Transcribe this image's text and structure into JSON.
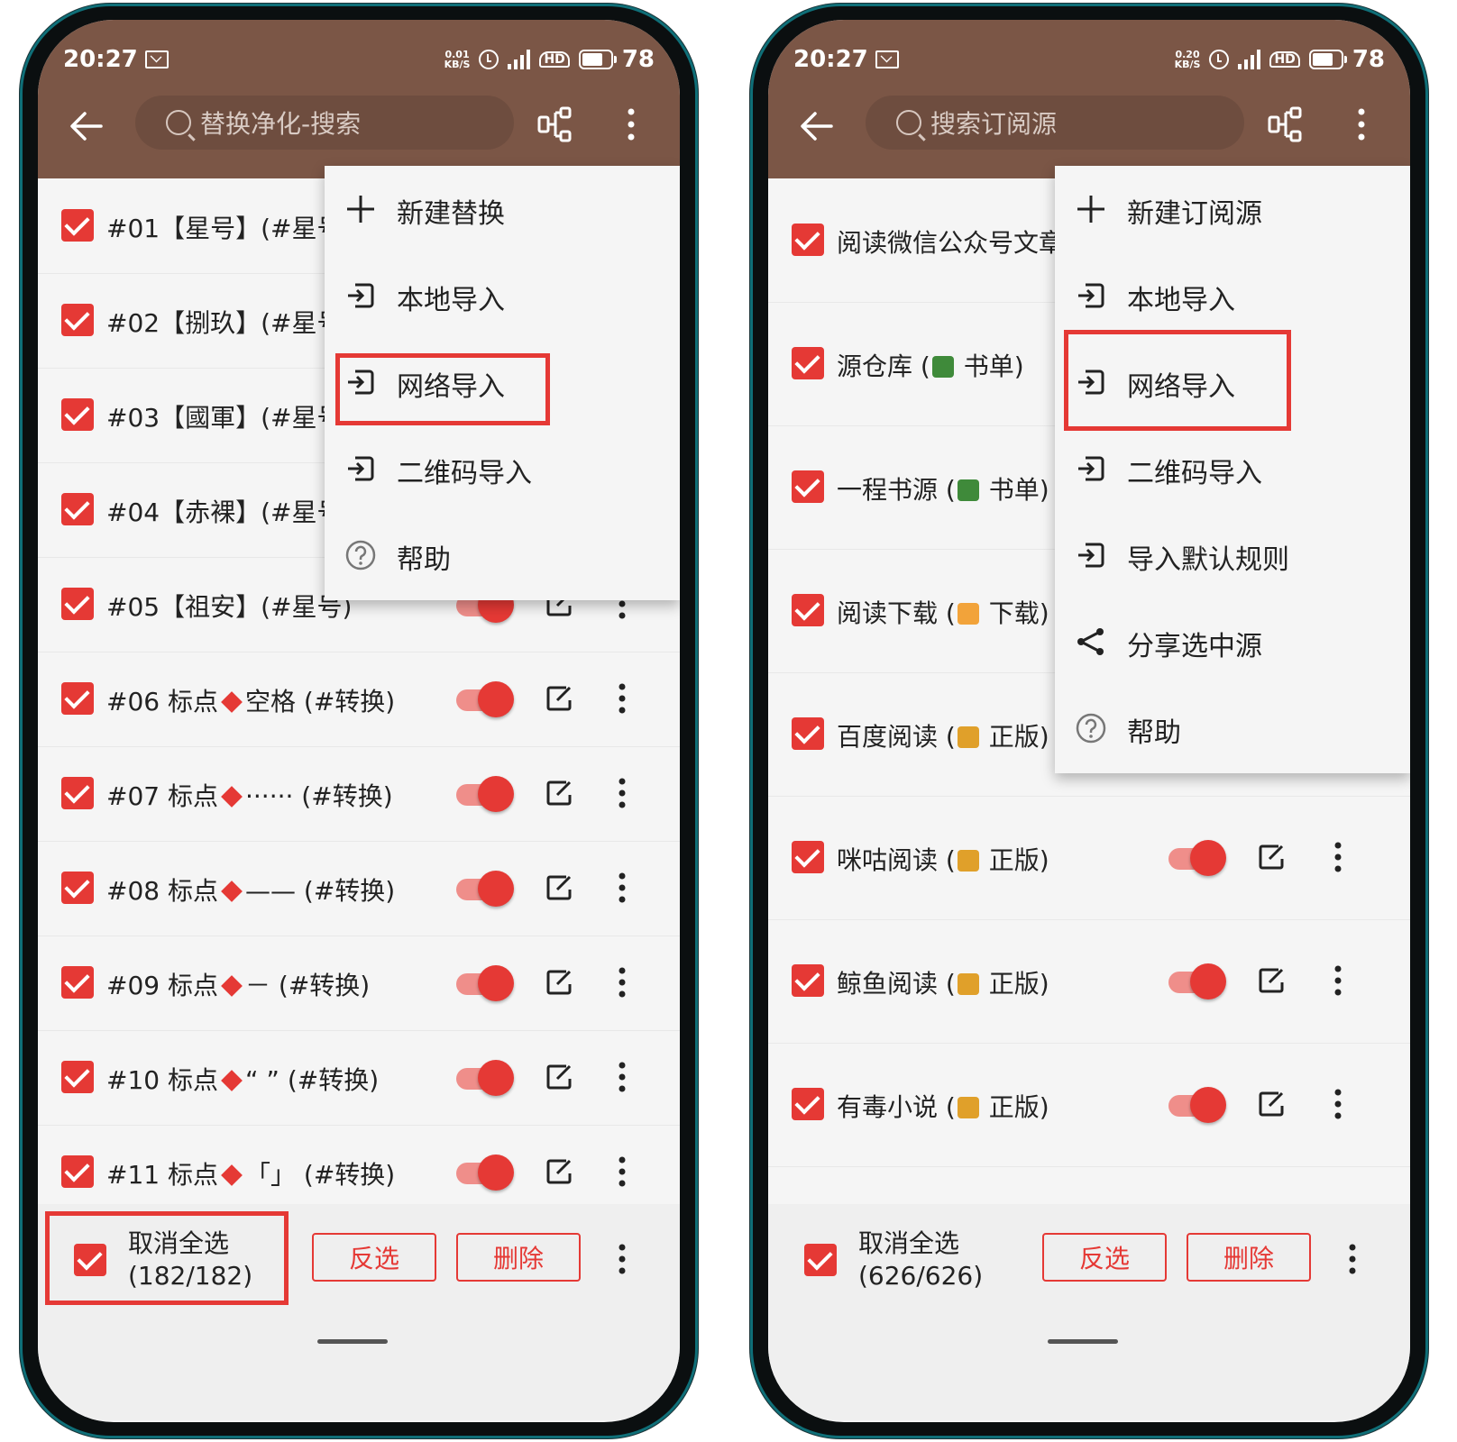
{
  "colors": {
    "appbar": "#7b5646",
    "accent": "#e53935",
    "toggle_track": "#ef8e8a"
  },
  "left": {
    "status": {
      "time": "20:27",
      "speed_top": "0.01",
      "speed_bottom": "KB/S",
      "battery": "78"
    },
    "search_placeholder": "替换净化-搜索",
    "rows": [
      {
        "text": "#01【星号】(#星号"
      },
      {
        "text": "#02【捌玖】(#星号"
      },
      {
        "text": "#03【國軍】(#星号"
      },
      {
        "text": "#04【赤裸】(#星号"
      },
      {
        "text": "#05【祖安】(#星号)"
      },
      {
        "text": "#06 标点",
        "mid": "空格 (#转换)"
      },
      {
        "text": "#07 标点",
        "mid": "······ (#转换)"
      },
      {
        "text": "#08 标点",
        "mid": "—— (#转换)"
      },
      {
        "text": "#09 标点",
        "mid": "－    (#转换)"
      },
      {
        "text": "#10 标点",
        "mid": "“ ”  (#转换)"
      },
      {
        "text": "#11 标点",
        "mid": "「」 (#转换)"
      }
    ],
    "menu": [
      {
        "icon": "plus-icon",
        "label": "新建替换"
      },
      {
        "icon": "import-icon",
        "label": "本地导入"
      },
      {
        "icon": "import-icon",
        "label": "网络导入"
      },
      {
        "icon": "import-icon",
        "label": "二维码导入"
      },
      {
        "icon": "help-icon",
        "label": "帮助"
      }
    ],
    "bottom": {
      "select_label": "取消全选",
      "count": "(182/182)",
      "invert": "反选",
      "delete": "删除"
    }
  },
  "right": {
    "status": {
      "time": "20:27",
      "speed_top": "0.20",
      "speed_bottom": "KB/S",
      "battery": "78"
    },
    "search_placeholder": "搜索订阅源",
    "rows": [
      {
        "text": "阅读微信公众号文章"
      },
      {
        "pre": "源仓库 (",
        "post": " 书单)"
      },
      {
        "pre": "一程书源 (",
        "post": " 书单)"
      },
      {
        "pre": "阅读下载 (",
        "post": " 下载)"
      },
      {
        "pre": "百度阅读 (",
        "post": " 正版)"
      },
      {
        "pre": "咪咕阅读 (",
        "post": " 正版)"
      },
      {
        "pre": "鲸鱼阅读 (",
        "post": " 正版)"
      },
      {
        "pre": "有毒小说 (",
        "post": " 正版)"
      }
    ],
    "menu": [
      {
        "icon": "plus-icon",
        "label": "新建订阅源"
      },
      {
        "icon": "import-icon",
        "label": "本地导入"
      },
      {
        "icon": "import-icon",
        "label": "网络导入"
      },
      {
        "icon": "import-icon",
        "label": "二维码导入"
      },
      {
        "icon": "import-icon",
        "label": "导入默认规则"
      },
      {
        "icon": "share-icon",
        "label": "分享选中源"
      },
      {
        "icon": "help-icon",
        "label": "帮助"
      }
    ],
    "bottom": {
      "select_label": "取消全选",
      "count": "(626/626)",
      "invert": "反选",
      "delete": "删除"
    }
  }
}
